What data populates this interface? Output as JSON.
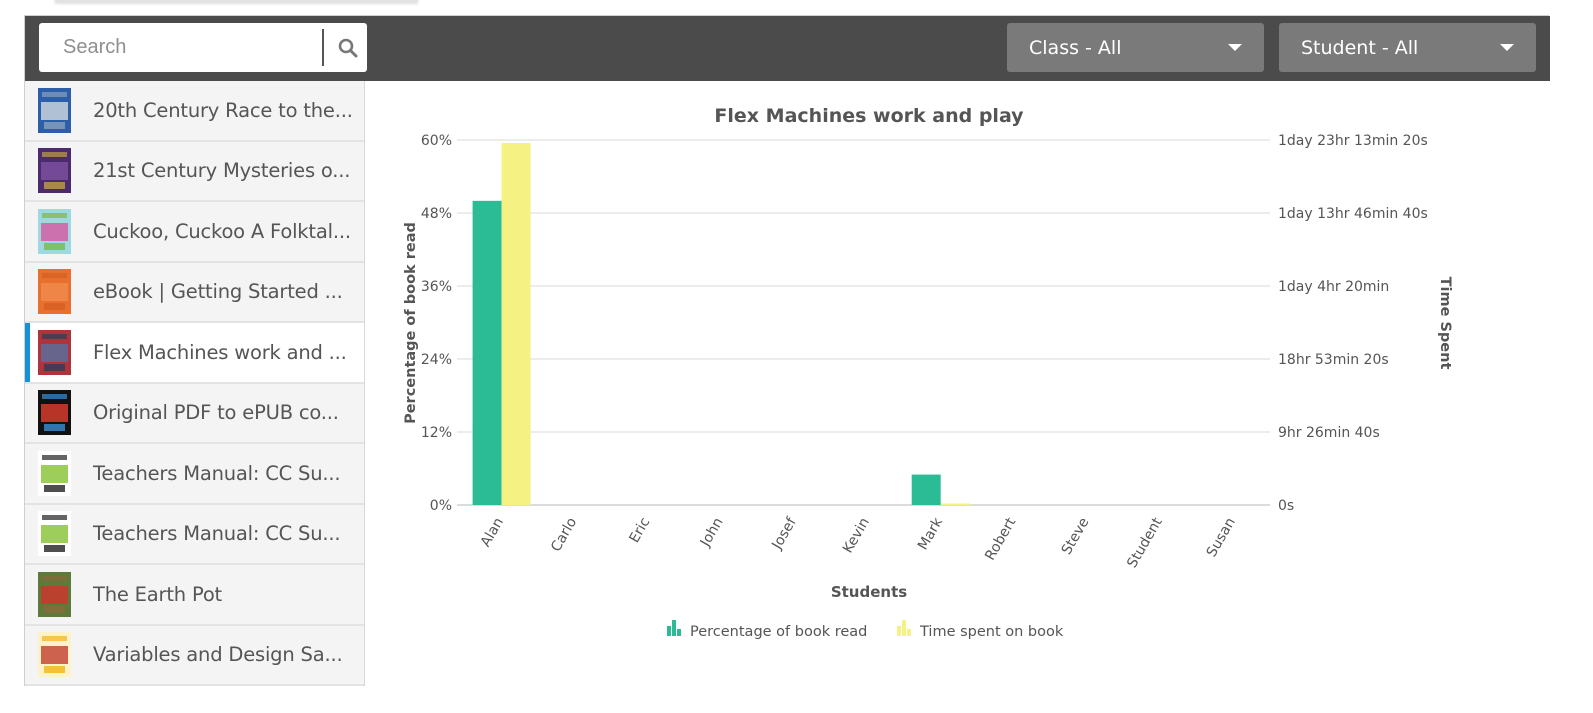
{
  "search": {
    "placeholder": "Search",
    "value": "",
    "icon": "search-icon"
  },
  "filters": {
    "class": {
      "label": "Class - All",
      "icon": "caret-down-icon"
    },
    "student": {
      "label": "Student - All",
      "icon": "caret-down-icon"
    }
  },
  "books": [
    {
      "title": "20th Century Race to the...",
      "active": false,
      "thumb_colors": [
        "#2d5ea8",
        "#c8d2de",
        "#8aa0bd"
      ]
    },
    {
      "title": "21st Century Mysteries o...",
      "active": false,
      "thumb_colors": [
        "#4b2a6e",
        "#7b4fa0",
        "#c0a040"
      ]
    },
    {
      "title": "Cuckoo, Cuckoo A Folktal...",
      "active": false,
      "thumb_colors": [
        "#9ed8e0",
        "#d45fa5",
        "#7cb84a"
      ]
    },
    {
      "title": "eBook | Getting Started ...",
      "active": false,
      "thumb_colors": [
        "#e8702e",
        "#f08a4c",
        "#d45f22"
      ]
    },
    {
      "title": "Flex Machines work and ...",
      "active": true,
      "thumb_colors": [
        "#b0323a",
        "#5a6f9a",
        "#2d3d5a"
      ]
    },
    {
      "title": "Original PDF to ePUB co...",
      "active": false,
      "thumb_colors": [
        "#111111",
        "#d63b2b",
        "#3a8fd6"
      ]
    },
    {
      "title": "Teachers Manual: CC Su...",
      "active": false,
      "thumb_colors": [
        "#ffffff",
        "#8cc63f",
        "#222222"
      ]
    },
    {
      "title": "Teachers Manual: CC Su...",
      "active": false,
      "thumb_colors": [
        "#ffffff",
        "#8cc63f",
        "#222222"
      ]
    },
    {
      "title": "The Earth Pot",
      "active": false,
      "thumb_colors": [
        "#5d7a3a",
        "#c9372c",
        "#8a6a3a"
      ]
    },
    {
      "title": "Variables and Design Sa...",
      "active": false,
      "thumb_colors": [
        "#fdf2c8",
        "#c44a3a",
        "#f2b41a"
      ]
    }
  ],
  "colors": {
    "toolbar_bg": "#4b4b4b",
    "dropdown_bg": "#7a7a7a",
    "active_indicator": "#1592d6",
    "series_percentage": "#2bbc96",
    "series_time": "#f5f283"
  },
  "chart_data": {
    "type": "bar",
    "title": "Flex Machines work and play",
    "xlabel": "Students",
    "ylabel": "Percentage of book read",
    "y2label": "Time Spent",
    "categories": [
      "Alan",
      "Carlo",
      "Eric",
      "John",
      "Josef",
      "Kevin",
      "Mark",
      "Robert",
      "Steve",
      "Student",
      "Susan"
    ],
    "ylim": [
      0,
      60
    ],
    "yticks": [
      0,
      12,
      24,
      36,
      48,
      60
    ],
    "ytick_labels": [
      "0%",
      "12%",
      "24%",
      "36%",
      "48%",
      "60%"
    ],
    "y2lim_seconds": [
      0,
      170000
    ],
    "y2ticks_seconds": [
      0,
      34000,
      68000,
      102000,
      136000,
      170000
    ],
    "y2tick_labels": [
      "0s",
      "9hr 26min 40s",
      "18hr 53min 20s",
      "1day 4hr 20min",
      "1day 13hr 46min 40s",
      "1day 23hr 13min 20s"
    ],
    "grid": true,
    "legend_position": "bottom-center",
    "series": [
      {
        "name": "Percentage of book read",
        "axis": "left",
        "unit": "percent",
        "color": "#2bbc96",
        "values": [
          50,
          0,
          0,
          0,
          0,
          0,
          5,
          0,
          0,
          0,
          0
        ]
      },
      {
        "name": "Time spent on book",
        "axis": "right",
        "unit": "seconds",
        "color": "#f5f283",
        "values": [
          168600,
          0,
          0,
          0,
          0,
          0,
          300,
          0,
          0,
          0,
          0
        ]
      }
    ]
  }
}
